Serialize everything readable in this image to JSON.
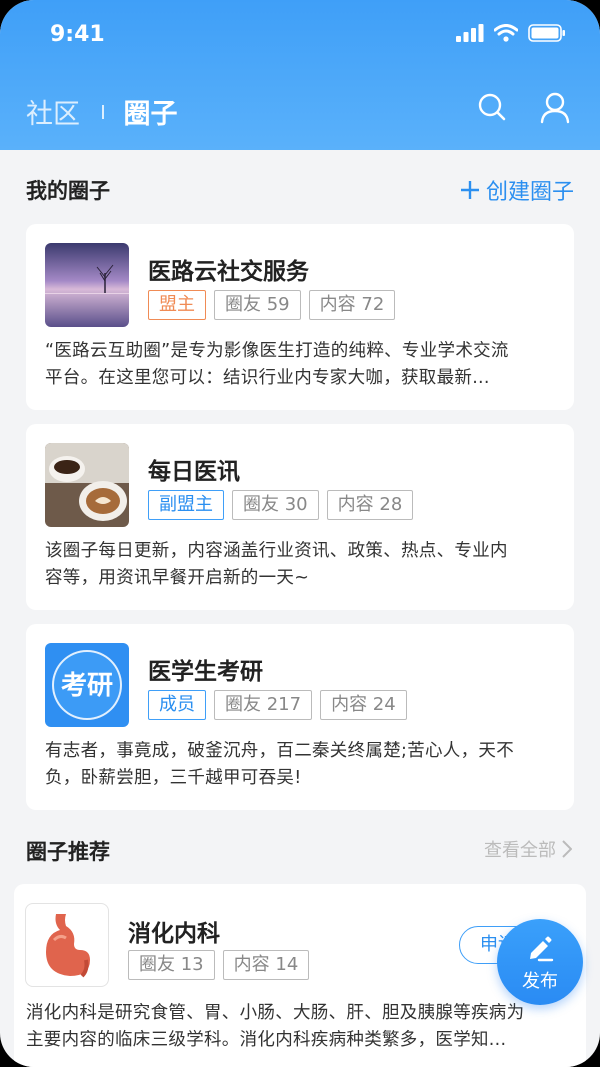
{
  "status_bar": {
    "time": "9:41"
  },
  "nav": {
    "tab_community": "社区",
    "tab_circles": "圈子"
  },
  "my_circles": {
    "title": "我的圈子",
    "create_label": "创建圈子",
    "items": [
      {
        "name": "医路云社交服务",
        "role": "盟主",
        "members": "圈友 59",
        "content": "内容 72",
        "desc_line1": "“医路云互助圈”是专为影像医生打造的纯粹、专业学术交流",
        "desc_line2": "平台。在这里您可以：结识行业内专家大咖，获取最新..."
      },
      {
        "name": "每日医讯",
        "role": "副盟主",
        "members": "圈友 30",
        "content": "内容 28",
        "desc_line1": "该圈子每日更新，内容涵盖行业资讯、政策、热点、专业内",
        "desc_line2": "容等，用资讯早餐开启新的一天~"
      },
      {
        "name": "医学生考研",
        "thumb_text": "考研",
        "role": "成员",
        "members": "圈友 217",
        "content": "内容 24",
        "desc_line1": "有志者，事竟成，破釜沉舟，百二秦关终属楚;苦心人，天不",
        "desc_line2": "负，卧薪尝胆，三千越甲可吞吴!"
      }
    ]
  },
  "recommend": {
    "title": "圈子推荐",
    "see_all": "查看全部",
    "item": {
      "name": "消化内科",
      "members": "圈友 13",
      "content": "内容 14",
      "apply_label": "申请",
      "desc_line1": "消化内科是研究食管、胃、小肠、大肠、肝、胆及胰腺等疾病为",
      "desc_line2": "主要内容的临床三级学科。消化内科疾病种类繁多，医学知..."
    }
  },
  "fab": {
    "label": "发布"
  },
  "colors": {
    "primary": "#3f9ff8",
    "owner": "#f08b55",
    "background": "#f3f4f6"
  }
}
